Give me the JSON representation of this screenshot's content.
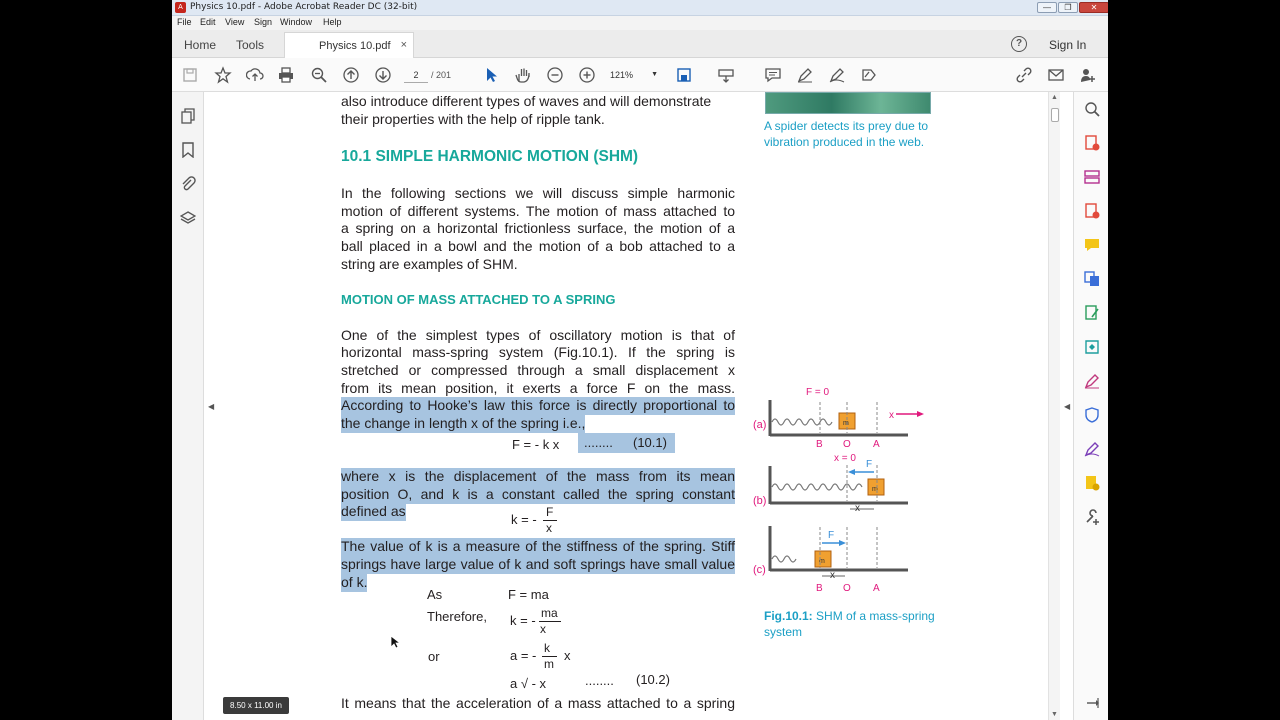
{
  "window": {
    "title": "Physics 10.pdf - Adobe Acrobat Reader DC (32-bit)",
    "min": "—",
    "restore": "❐",
    "close": "✕"
  },
  "menu": [
    "File",
    "Edit",
    "View",
    "Sign",
    "Window",
    "Help"
  ],
  "tabs": {
    "home": "Home",
    "tools": "Tools",
    "document": "Physics 10.pdf",
    "close": "×"
  },
  "account": {
    "help": "?",
    "signin": "Sign In"
  },
  "toolbar": {
    "page_current": "2",
    "page_total": "/ 201",
    "zoom": "121%",
    "zoom_caret": "▼"
  },
  "page": {
    "intro_line1": "also introduce different types of waves and will demonstrate",
    "intro_line2": "their properties with the help of ripple tank.",
    "section_heading": "10.1   SIMPLE HARMONIC MOTION (SHM)",
    "para1": [
      "In the following sections we will discuss simple harmonic",
      "motion of different systems. The motion of mass attached to",
      "a spring on a horizontal frictionless surface, the motion of a",
      "ball placed in a bowl and the motion of a bob attached to a",
      "string are examples of SHM."
    ],
    "subheading": "MOTION OF MASS ATTACHED TO A SPRING",
    "para2": [
      "One of the simplest types of oscillatory motion is that of",
      "horizontal mass-spring system (Fig.10.1). If the spring is",
      "stretched or compressed through a small displacement x",
      "from its mean position, it exerts a force F on the mass."
    ],
    "hooke": [
      "According to Hooke’s law this force is directly proportional to",
      "the change in length x of the spring i.e.,"
    ],
    "eq1": "F = - k x",
    "eq1_dots": "........",
    "eq1_num": "(10.1)",
    "where": [
      "where  x  is the displacement of the mass from its mean",
      "position O, and k is a constant called the spring constant",
      "defined as"
    ],
    "eq_k": "k = -",
    "eq_k_num": "F",
    "eq_k_den": "x",
    "stiff": [
      "The value of k is a measure of the stiffness of the spring. Stiff",
      "springs have large value of k and soft springs have small value",
      "of  k."
    ],
    "as_label": "As",
    "as_eq": "F =  ma",
    "therefore_label": "Therefore,",
    "therefore_eq": "k = -",
    "therefore_num": "ma",
    "therefore_den": "x",
    "or_label": "or",
    "or_eq": "a = -",
    "or_num": "k",
    "or_den": "m",
    "or_tail": "x",
    "prop_eq": "a  √  -  x",
    "prop_dots": "........",
    "prop_num": "(10.2)",
    "last_line": "It means that the acceleration of a mass attached to a spring"
  },
  "sidebar": {
    "spider_caption": [
      "A spider detects its prey due to",
      "vibration produced in the web."
    ],
    "fig_caption_bold": "Fig.10.1:",
    "fig_caption_rest": " SHM of a mass-spring",
    "fig_caption_line2": "system"
  },
  "figure": {
    "f0": "F = 0",
    "x0": "x = 0",
    "a": "(a)",
    "b": "(b)",
    "c": "(c)",
    "B": "B",
    "O": "O",
    "A": "A",
    "x": "x",
    "F": "F",
    "m": "m"
  },
  "status": {
    "size": "8.50 x 11.00 in"
  },
  "colors": {
    "accent": "#17a89b",
    "highlight": "#a7c4e0",
    "caption": "#1b9fc5",
    "arrow": "#e0197d"
  }
}
